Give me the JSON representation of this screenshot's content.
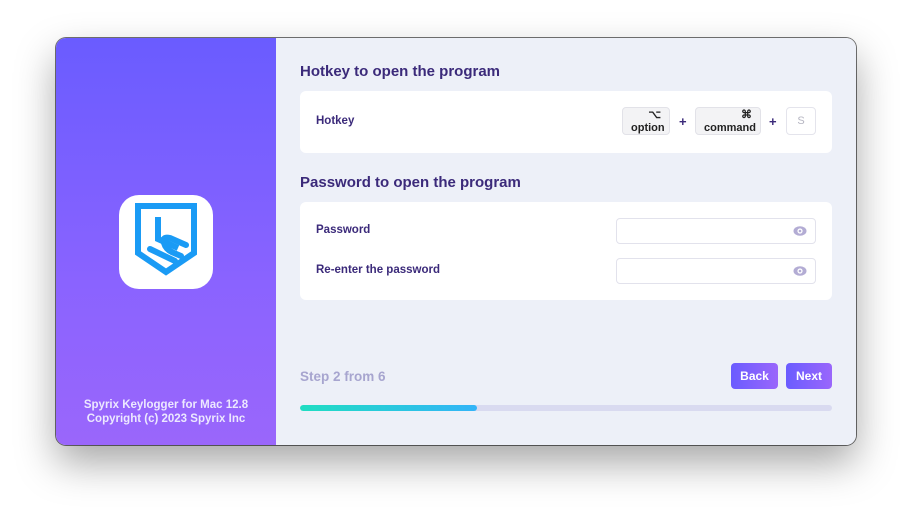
{
  "sidebar": {
    "app_icon": "shield-s-logo",
    "product_line": "Spyrix Keylogger for Mac 12.8",
    "copyright_line": "Copyright (c) 2023 Spyrix Inc"
  },
  "hotkey_section": {
    "title": "Hotkey to open the program",
    "label": "Hotkey",
    "keys": [
      {
        "symbol": "⌥",
        "name": "option"
      },
      {
        "symbol": "⌘",
        "name": "command"
      }
    ],
    "plus": "+",
    "letter_key": "S"
  },
  "password_section": {
    "title": "Password to open the program",
    "password_label": "Password",
    "password_value": "",
    "reenter_label": "Re-enter the password",
    "reenter_value": "",
    "eye_icon": "eye-icon"
  },
  "footer": {
    "step_text": "Step 2 from 6",
    "back_label": "Back",
    "next_label": "Next",
    "progress_fraction": 0.333
  },
  "colors": {
    "accent_start": "#6a5cff",
    "accent_end": "#9a66fb",
    "heading": "#3b2a7a",
    "progress_start": "#20ddc2",
    "progress_end": "#33b4f8",
    "logo_blue": "#1a9bf5"
  }
}
